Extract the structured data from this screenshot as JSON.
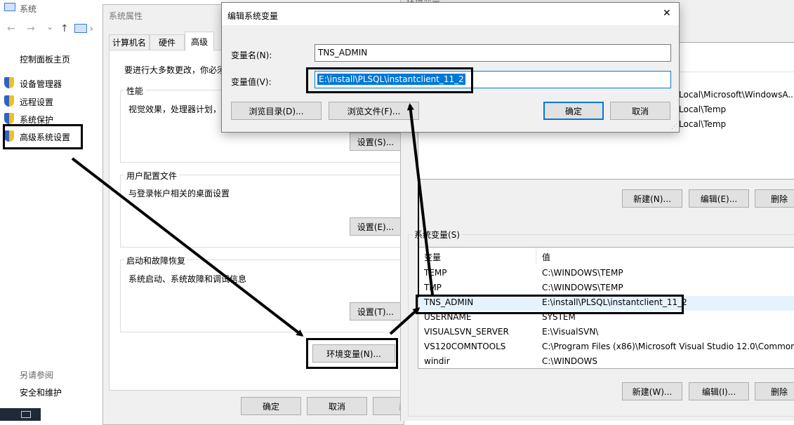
{
  "system_window": {
    "title": "系统",
    "nav": {
      "back": "←",
      "forward": "→",
      "dropdown": "⌄",
      "up": "↑"
    },
    "control_panel_home": "控制面板主页",
    "links": [
      {
        "label": "设备管理器"
      },
      {
        "label": "远程设置"
      },
      {
        "label": "系统保护"
      },
      {
        "label": "高级系统设置"
      }
    ],
    "see_also": "另请参阅",
    "security": "安全和维护"
  },
  "sysprops": {
    "title": "系统属性",
    "tabs": [
      "计算机名",
      "硬件",
      "高级"
    ],
    "admin_note": "要进行大多数更改，你必须",
    "perf": {
      "label": "性能",
      "desc": "视觉效果，处理器计划，",
      "button": "设置(S)..."
    },
    "profile": {
      "label": "用户配置文件",
      "desc": "与登录帐户相关的桌面设置",
      "button": "设置(E)..."
    },
    "startup": {
      "label": "启动和故障恢复",
      "desc": "系统启动、系统故障和调试信息",
      "button": "设置(T)..."
    },
    "env_button": "环境变量(N)...",
    "ok": "确定",
    "cancel": "取消",
    "apply": "应"
  },
  "env_window": {
    "title": "环境变量",
    "user_rows": [
      {
        "value": "Local\\Microsoft\\WindowsA..."
      },
      {
        "value": "Local\\Temp"
      },
      {
        "value": "Local\\Temp"
      }
    ],
    "user_buttons": {
      "new": "新建(N)...",
      "edit": "编辑(E)...",
      "delete": "删除"
    },
    "system_label": "系统变量(S)",
    "columns": {
      "var": "变量",
      "val": "值"
    },
    "system_rows": [
      {
        "name": "TEMP",
        "value": "C:\\WINDOWS\\TEMP"
      },
      {
        "name": "TMP",
        "value": "C:\\WINDOWS\\TEMP"
      },
      {
        "name": "TNS_ADMIN",
        "value": "E:\\install\\PLSQL\\instantclient_11_2"
      },
      {
        "name": "USERNAME",
        "value": "SYSTEM"
      },
      {
        "name": "VISUALSVN_SERVER",
        "value": "E:\\VisualSVN\\"
      },
      {
        "name": "VS120COMNTOOLS",
        "value": "C:\\Program Files (x86)\\Microsoft Visual Studio 12.0\\Common..."
      },
      {
        "name": "windir",
        "value": "C:\\WINDOWS"
      }
    ],
    "system_buttons": {
      "new": "新建(W)...",
      "edit": "编辑(I)...",
      "delete": "删除"
    }
  },
  "edit_dialog": {
    "title": "编辑系统变量",
    "close": "✕",
    "name_label": "变量名(N):",
    "name_value": "TNS_ADMIN",
    "value_label": "变量值(V):",
    "value_value": "E:\\install\\PLSQL\\instantclient_11_2",
    "browse_dir": "浏览目录(D)...",
    "browse_file": "浏览文件(F)...",
    "ok": "确定",
    "cancel": "取消"
  },
  "colors": {
    "selection": "#0078d7",
    "highlight_row": "#e5f3ff",
    "annotation": "#000000"
  }
}
